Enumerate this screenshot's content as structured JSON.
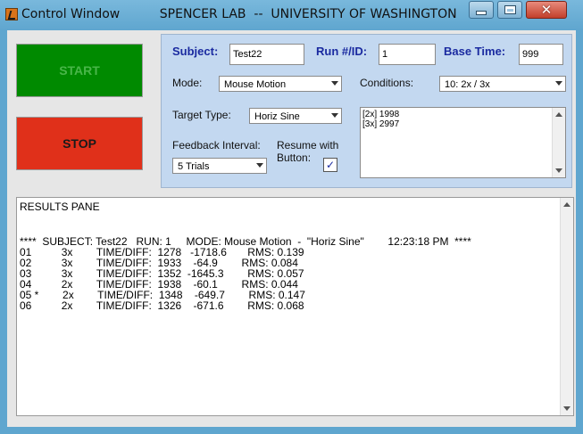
{
  "window": {
    "title": "Control Window",
    "subtitle": "SPENCER LAB  --  UNIVERSITY OF WASHINGTON",
    "min_icon": "minimize-icon",
    "max_icon": "maximize-icon",
    "close_icon": "close-icon",
    "colors": {
      "titlebar": "#5fa6cf",
      "close": "#c2402c"
    }
  },
  "buttons": {
    "start_label": "START",
    "stop_label": "STOP",
    "start_color": "#008a00",
    "stop_color": "#e0301a"
  },
  "form": {
    "subject_label": "Subject:",
    "subject_value": "Test22",
    "run_label": "Run #/ID:",
    "run_value": "1",
    "base_time_label": "Base Time:",
    "base_time_value": "999",
    "mode_label": "Mode:",
    "mode_value": "Mouse Motion",
    "conditions_label": "Conditions:",
    "conditions_value": "10: 2x / 3x",
    "target_type_label": "Target Type:",
    "target_type_value": "Horiz Sine",
    "feedback_label": "Feedback Interval:",
    "feedback_value": "5 Trials",
    "resume_label_1": "Resume with",
    "resume_label_2": "Button:",
    "resume_checked": true,
    "conditions_list": [
      "[2x] 1998",
      "[3x] 2997"
    ],
    "panel_color": "#c3d8f0"
  },
  "results": {
    "title": "RESULTS PANE",
    "header": "****  SUBJECT: Test22   RUN: 1     MODE: Mouse Motion  -  \"Horiz Sine\"        12:23:18 PM  ****",
    "rows": [
      "01          3x        TIME/DIFF:  1278   -1718.6       RMS: 0.139",
      "02          3x        TIME/DIFF:  1933    -64.9        RMS: 0.084",
      "03          3x        TIME/DIFF:  1352  -1645.3        RMS: 0.057",
      "04          2x        TIME/DIFF:  1938    -60.1        RMS: 0.044",
      "05 *        2x        TIME/DIFF:  1348    -649.7        RMS: 0.147",
      "06          2x        TIME/DIFF:  1326    -671.6        RMS: 0.068"
    ]
  }
}
